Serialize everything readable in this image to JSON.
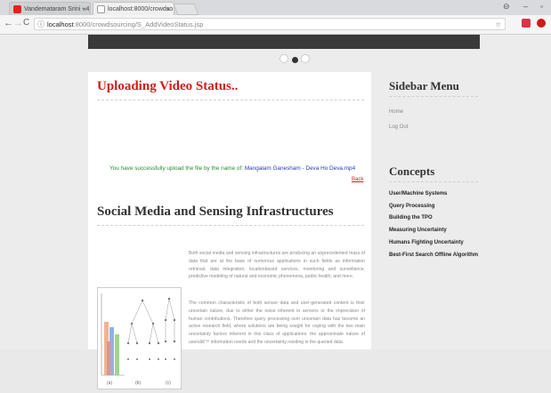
{
  "browser": {
    "tabs": [
      {
        "title": "Vandemataram Srini - ",
        "badge": "4)"
      },
      {
        "title": "localhost:8000/crowdso"
      }
    ],
    "close_glyph": "×",
    "url_host": "localhost",
    "url_path": ":8000/crowdsourcing/S_AddVideoStatus.jsp",
    "nav": {
      "back": "←",
      "forward": "→",
      "reload": "C",
      "info": "ⓘ"
    },
    "window": {
      "profile": "⊖",
      "minimize": "–",
      "maximize": "▫"
    },
    "star": "☆"
  },
  "main": {
    "upload_title": "Uploading Video Status..",
    "success_prefix": "You have successfully upload the file by the name of: ",
    "success_filename": "Mangalam Ganesham - Deva Ho Deva.mp4",
    "back_link": "Back",
    "section_title": "Social Media and Sensing Infrastructures",
    "paragraph1": "Both social media and sensing infrastructures are producing an unprecedented mass of data that are at the base of numerous applications in such fields as information retrieval, data integration, locationbased services, monitoring and surveillance, predictive modeling of natural and economic phenomena, public health, and more.",
    "paragraph2": "The common characteristic of both sensor data and user-generated content is their uncertain nature, due to either the noise inherent in sensors or the imprecision of human contributions. Therefore query processing over uncertain data has become an active research field, where solutions are being sought for coping with the two main uncertainty factors inherent in this class of applications: the approximate nature of usersâ€™ information needs and the uncertainty residing in the queried data.",
    "figure_captions": [
      "(a)",
      "(b)",
      "(c)"
    ]
  },
  "sidebar": {
    "menu_title": "Sidebar Menu",
    "menu_items": [
      "Home",
      "Log Out"
    ],
    "concepts_title": "Concepts",
    "concepts": [
      "User/Machine Systems",
      "Query Processing",
      "Building the TPO",
      "Measuring Uncertainty",
      "Humans Fighting Uncertainty",
      "Best-First Search Offline Algorithm"
    ]
  },
  "colors": {
    "title_red": "#d11b1b",
    "success_green": "#2e8b2e",
    "filename_blue": "#2a3eb0"
  }
}
